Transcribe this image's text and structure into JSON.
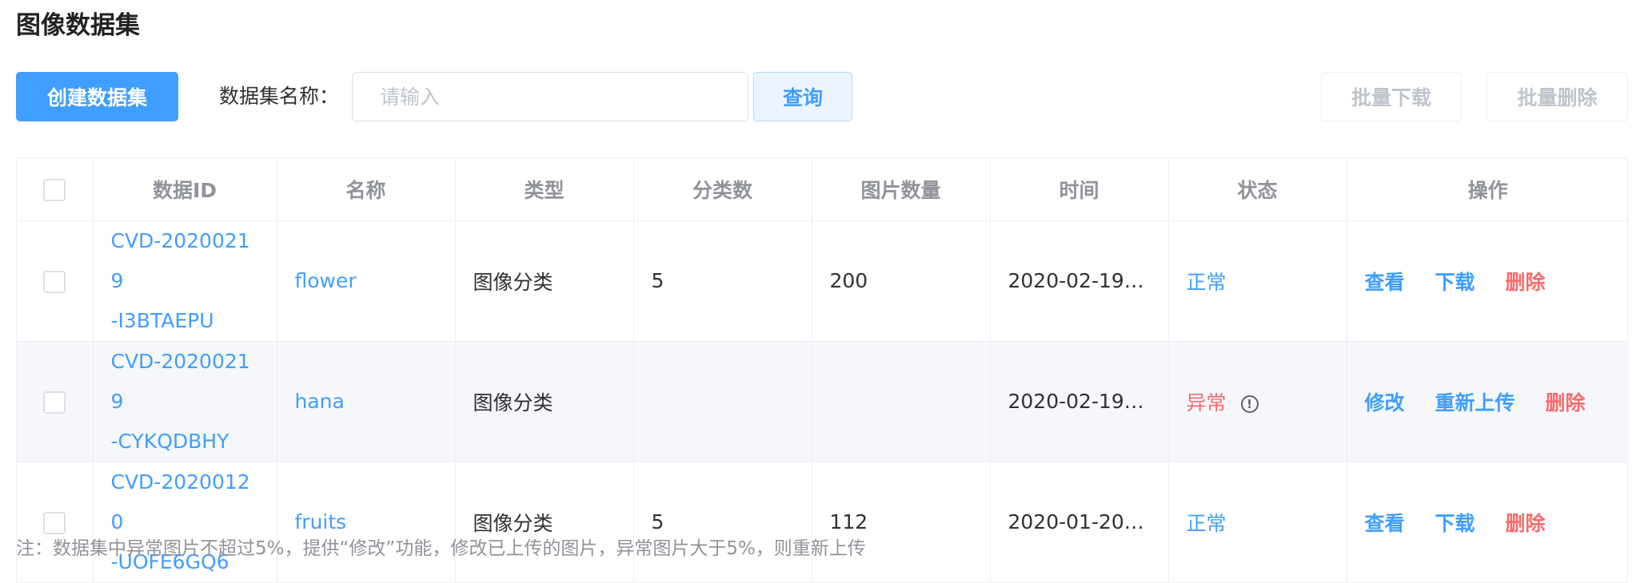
{
  "page": {
    "title": "图像数据集"
  },
  "toolbar": {
    "create_label": "创建数据集",
    "search_label": "数据集名称：",
    "search_placeholder": "请输入",
    "search_value": "",
    "query_label": "查询",
    "batch_download_label": "批量下载",
    "batch_delete_label": "批量删除"
  },
  "table": {
    "headers": {
      "id": "数据ID",
      "name": "名称",
      "type": "类型",
      "categories": "分类数",
      "images": "图片数量",
      "time": "时间",
      "status": "状态",
      "actions": "操作"
    },
    "rows": [
      {
        "id_line1": "CVD-20200219",
        "id_line2": "-I3BTAEPU",
        "name": "flower",
        "type": "图像分类",
        "categories": "5",
        "images": "200",
        "time": "2020-02-19 …",
        "status": "正常",
        "actions": [
          "查看",
          "下载",
          "删除"
        ]
      },
      {
        "id_line1": "CVD-20200219",
        "id_line2": "-CYKQDBHY",
        "name": "hana",
        "type": "图像分类",
        "categories": "",
        "images": "",
        "time": "2020-02-19 …",
        "status": "异常",
        "status_icon": "!",
        "actions": [
          "修改",
          "重新上传",
          "删除"
        ]
      },
      {
        "id_line1": "CVD-20200120",
        "id_line2": "-UOFE6GQ6",
        "name": "fruits",
        "type": "图像分类",
        "categories": "5",
        "images": "112",
        "time": "2020-01-20 …",
        "status": "正常",
        "actions": [
          "查看",
          "下载",
          "删除"
        ]
      }
    ]
  },
  "note": "注：数据集中异常图片不超过5%，提供“修改”功能，修改已上传的图片，异常图片大于5%，则重新上传",
  "colors": {
    "primary": "#409eff",
    "danger": "#f56c6c",
    "header_text": "#909399",
    "stripe": "#f5f7fa"
  },
  "icons": {
    "status_warning": "info-circle-icon"
  }
}
